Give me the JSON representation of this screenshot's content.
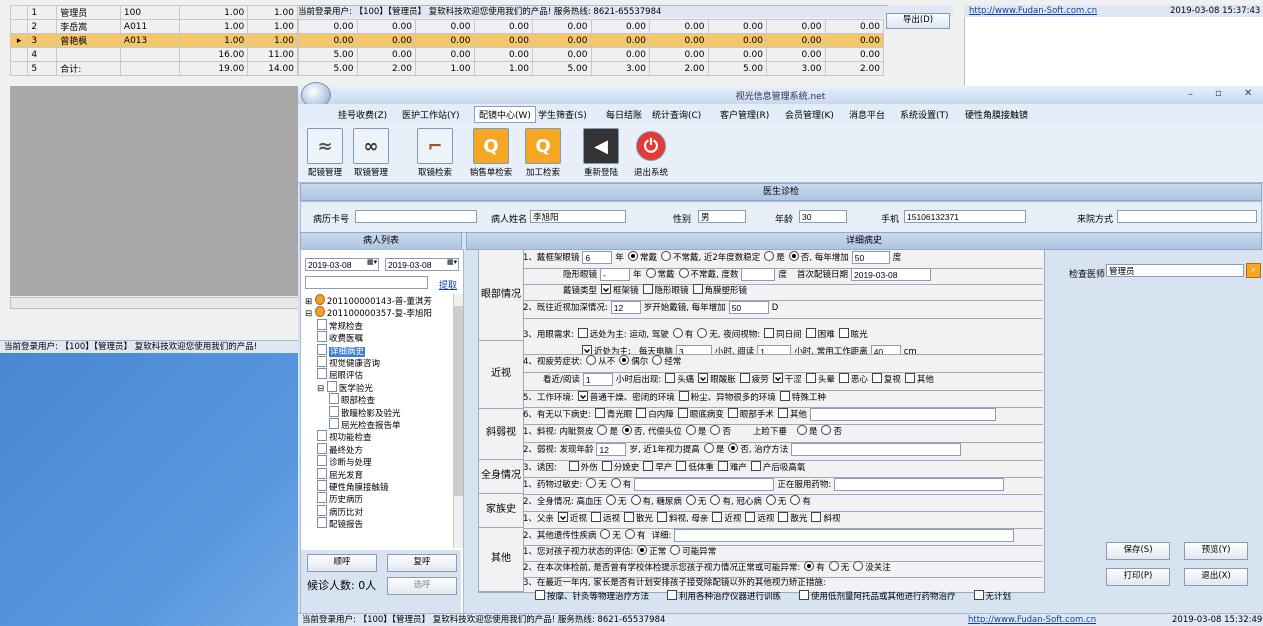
{
  "bg": {
    "rows": [
      {
        "no": "1",
        "name": "管理员",
        "code": "100",
        "c1": "1.00",
        "c2": "1.00",
        "sel": false
      },
      {
        "no": "2",
        "name": "李岳嵩",
        "code": "A011",
        "c1": "1.00",
        "c2": "1.00",
        "sel": false,
        "extra": [
          "0.00",
          "0.00",
          "0.00",
          "0.00",
          "0.00",
          "0.00",
          "0.00",
          "0.00",
          "0.00",
          "0.00"
        ]
      },
      {
        "no": "3",
        "name": "曾艳枫",
        "code": "A013",
        "c1": "1.00",
        "c2": "1.00",
        "sel": true,
        "extra": [
          "0.00",
          "0.00",
          "0.00",
          "0.00",
          "0.00",
          "0.00",
          "0.00",
          "0.00",
          "0.00",
          "0.00"
        ]
      },
      {
        "no": "4",
        "name": "",
        "code": "",
        "c1": "16.00",
        "c2": "11.00",
        "sel": false,
        "extra": [
          "5.00",
          "0.00",
          "0.00",
          "0.00",
          "0.00",
          "0.00",
          "0.00",
          "0.00",
          "0.00",
          "0.00"
        ]
      },
      {
        "no": "5",
        "name": "合计:",
        "code": "",
        "c1": "19.00",
        "c2": "14.00",
        "sel": false,
        "extra": [
          "5.00",
          "2.00",
          "1.00",
          "1.00",
          "5.00",
          "3.00",
          "2.00",
          "5.00",
          "3.00",
          "2.00"
        ]
      }
    ],
    "top_status": "当前登录用户: 【100】【管理员】    复软科技欢迎您使用我们的产品!    服务热线: 8621-65537984",
    "top_link": "http://www.Fudan-Soft.com.cn",
    "top_time": "2019-03-08 15:37:43",
    "export_label": "导出(D)",
    "left_status": "当前登录用户: 【100】【管理员】    复软科技欢迎您使用我们的产品!"
  },
  "app": {
    "title": "视光信息管理系统.net",
    "menus": [
      "挂号收费(Z)",
      "医护工作站(Y)",
      "配镜中心(W)",
      "学生筛查(S)",
      "每日结账",
      "统计查询(C)",
      "客户管理(R)",
      "会员管理(K)",
      "消息平台",
      "系统设置(T)",
      "硬性角膜接触镜"
    ],
    "toolbar": [
      "配镜管理",
      "取镜管理",
      "取镜检索",
      "销售单检索",
      "加工检索",
      "重新登陆",
      "退出系统"
    ],
    "section_title": "医生诊检",
    "patient": {
      "record_label": "病历卡号",
      "record_value": "",
      "name_label": "病人姓名",
      "name_value": "李旭阳",
      "sex_label": "性别",
      "sex_value": "男",
      "age_label": "年龄",
      "age_value": "30",
      "phone_label": "手机",
      "phone_value": "15106132371",
      "visit_label": "来院方式",
      "visit_value": ""
    },
    "list_title": "病人列表",
    "detail_title": "详细病史",
    "date_from": "2019-03-08",
    "date_to": "2019-03-08",
    "fetch_label": "提取",
    "tree": [
      "201100000143-普-董淇芳",
      "201100000357-复-李旭阳",
      "常规检查",
      "收费医嘱",
      "详细病史",
      "视觉健康咨询",
      "屈眼评估",
      "医学验光",
      "眼部检查",
      "散瞳检影及验光",
      "屈光检查报告单",
      "视功能检查",
      "最终处方",
      "诊断与处理",
      "屈光发育",
      "硬性角膜接触镜",
      "历史病历",
      "病历比对",
      "配镜报告"
    ],
    "call_label": "顺呼",
    "recall_label": "复呼",
    "waiting": "候诊人数: 0人",
    "skip_label": "选呼",
    "exam_doctor_label": "检查医师",
    "exam_doctor_value": "管理员",
    "buttons": {
      "save": "保存(S)",
      "preview": "预览(Y)",
      "print": "打印(P)",
      "exit": "退出(X)"
    },
    "status": "当前登录用户: 【100】【管理员】    复软科技欢迎您使用我们的产品!    服务热线: 8621-65537984",
    "link": "http://www.Fudan-Soft.com.cn",
    "time": "2019-03-08 15:32:49",
    "cats": {
      "eye": "眼部情况",
      "myopia": "近视",
      "squint": "斜弱视",
      "body": "全身情况",
      "family": "家族史",
      "other": "其他"
    },
    "rows": {
      "r1a": "1、戴框架眼镜",
      "r1a_val": "6",
      "r1a_b": "年",
      "r1a_c": "常戴",
      "r1a_d": "不常戴",
      "r1a_e": ", 近2年度数稳定",
      "r1a_f": "是",
      "r1a_g": "否",
      "r1a_h": ", 每年增加",
      "r1a_val2": "50",
      "r1a_i": "度",
      "r1b": "隐形眼镜",
      "r1b_val": "-",
      "r1b_b": "年",
      "r1b_c": "常戴",
      "r1b_d": "不常戴",
      "r1b_e": ", 度数",
      "r1b_f": "度",
      "r1b_g": "首次配镜日期",
      "r1b_date": "2019-03-08",
      "r1c": "戴镜类型",
      "r1c_a": "框架镜",
      "r1c_b": "隐形眼镜",
      "r1c_c": "角膜塑形镜",
      "r2": "2、既往近视加深情况:",
      "r2_val": "12",
      "r2_b": "岁开始戴镜, 每年增加",
      "r2_val2": "50",
      "r2_c": "D",
      "r3a": "3、用眼需求:",
      "r3a_a": "远处为主: 运动, 驾驶",
      "r3a_b": "有",
      "r3a_c": "无",
      "r3a_d": ", 夜间视物:",
      "r3a_e": "同日间",
      "r3a_f": "困难",
      "r3a_g": "眩光",
      "r3b_a": "近处为主:",
      "r3b_b": "每天电脑",
      "r3b_val": "3",
      "r3b_c": "小时, 阅读",
      "r3b_val2": "1",
      "r3b_d": "小时, 常用工作距离",
      "r3b_val3": "40",
      "r3b_e": "cm",
      "r4a": "4、视疲劳症状:",
      "r4a_a": "从不",
      "r4a_b": "偶尔",
      "r4a_c": "经常",
      "r4b": "看近/阅读",
      "r4b_val": "1",
      "r4b_a": "小时后出现:",
      "r4b_b": "头痛",
      "r4b_c": "眼酸胀",
      "r4b_d": "疲劳",
      "r4b_e": "干涩",
      "r4b_f": "头晕",
      "r4b_g": "恶心",
      "r4b_h": "复视",
      "r4b_i": "其他",
      "r5": "5、工作环境:",
      "r5_a": "普通干燥、密闭的环境",
      "r5_b": "粉尘、异物很多的环境",
      "r5_c": "特殊工种",
      "r6": "6、有无以下病史:",
      "r6_a": "青光眼",
      "r6_b": "白内障",
      "r6_c": "眼底病变",
      "r6_d": "眼部手术",
      "r6_e": "其他",
      "s1": "1、斜视: 内眦赘皮",
      "s1_a": "是",
      "s1_b": "否",
      "s1_c": ", 代偿头位",
      "s1_d": "是",
      "s1_e": "否",
      "s1_f": "上睑下垂",
      "s1_g": "是",
      "s1_h": "否",
      "s2": "2、弱视: 发现年龄",
      "s2_val": "12",
      "s2_a": "岁, 近1年视力提高",
      "s2_b": "是",
      "s2_c": "否",
      "s2_d": ", 治疗方法",
      "s3": "3、诱因:",
      "s3_a": "外伤",
      "s3_b": "分娩史",
      "s3_c": "早产",
      "s3_d": "低体重",
      "s3_e": "难产",
      "s3_f": "产后吸高氧",
      "b1": "1、药物过敏史:",
      "b1_a": "无",
      "b1_b": "有",
      "b1_c": "正在服用药物:",
      "b2": "2、全身情况: 高血压",
      "b2_a": "无",
      "b2_b": "有",
      "b2_c": ", 糖尿病",
      "b2_d": "无",
      "b2_e": "有",
      "b2_f": ", 冠心病",
      "b2_g": "无",
      "b2_h": "有",
      "f1": "1、父亲",
      "f1_a": "近视",
      "f1_b": "远视",
      "f1_c": "散光",
      "f1_d": "斜视",
      "f1_e": ", 母亲",
      "f1_f": "近视",
      "f1_g": "远视",
      "f1_h": "散光",
      "f1_i": "斜视",
      "f2": "2、其他遗传性疾病",
      "f2_a": "无",
      "f2_b": "有",
      "f2_c": "详细:",
      "o1": "1、您对孩子视力状态的评估:",
      "o1_a": "正常",
      "o1_b": "可能异常",
      "o2": "2、在本次体检前, 是否曾有学校体检提示您孩子视力情况正常或可能异常:",
      "o2_a": "有",
      "o2_b": "无",
      "o2_c": "没关注",
      "o3": "3、在最近一年内, 家长是否有计划安排孩子接受除配镜以外的其他视力矫正措施:",
      "o3_a": "按摩、针灸等物理治疗方法",
      "o3_b": "利用各种治疗仪器进行训练",
      "o3_c": "使用低剂量阿托品或其他进行药物治疗",
      "o3_d": "无计划"
    }
  }
}
